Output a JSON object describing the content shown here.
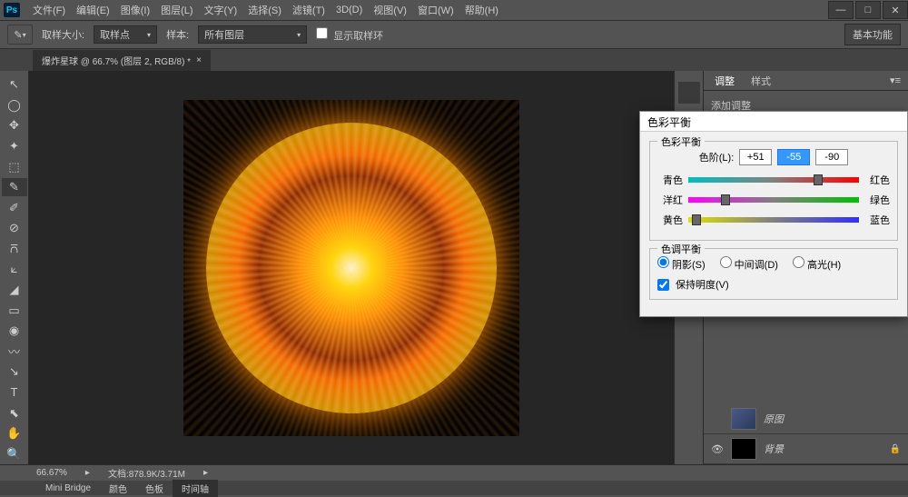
{
  "app": {
    "logo": "Ps"
  },
  "menu": {
    "items": [
      "文件(F)",
      "编辑(E)",
      "图像(I)",
      "图层(L)",
      "文字(Y)",
      "选择(S)",
      "滤镜(T)",
      "3D(D)",
      "视图(V)",
      "窗口(W)",
      "帮助(H)"
    ]
  },
  "options": {
    "sample_size_label": "取样大小:",
    "sample_size_value": "取样点",
    "sample_label": "样本:",
    "sample_value": "所有图层",
    "show_ring": "显示取样环",
    "func_btn": "基本功能"
  },
  "doc_tab": {
    "title": "爆炸星球 @ 66.7% (图层 2, RGB/8) *"
  },
  "tools": [
    "↖",
    "◯",
    "✥",
    "✦",
    "⬚",
    "✎",
    "✐",
    "⊘",
    "⩃",
    "⟀",
    "◢",
    "▭",
    "◉",
    "〰",
    "↘",
    "T",
    "⬉",
    "✋",
    "🔍"
  ],
  "right": {
    "tabs": [
      "调整",
      "样式"
    ],
    "add_adjust": "添加调整"
  },
  "layers": [
    {
      "name": "原图",
      "thumb_bg": "linear-gradient(135deg,#4a5a8a,#2a3a5a)"
    },
    {
      "name": "背景",
      "thumb_bg": "#000",
      "locked": true,
      "visible": true
    }
  ],
  "status": {
    "zoom": "66.67%",
    "doc_label": "文档:",
    "doc_size": "878.9K/3.71M"
  },
  "bottom_tabs": [
    "Mini Bridge",
    "颜色",
    "色板",
    "时间轴"
  ],
  "dialog": {
    "title": "色彩平衡",
    "group1_title": "色彩平衡",
    "levels_label": "色阶(L):",
    "level1": "+51",
    "level2": "-55",
    "level3": "-90",
    "sliders": [
      {
        "left": "青色",
        "right": "红色",
        "pos": 76
      },
      {
        "left": "洋红",
        "right": "绿色",
        "pos": 22
      },
      {
        "left": "黄色",
        "right": "蓝色",
        "pos": 5
      }
    ],
    "group2_title": "色调平衡",
    "radio_shadows": "阴影(S)",
    "radio_midtones": "中间调(D)",
    "radio_highlights": "高光(H)",
    "preserve_lum": "保持明度(V)"
  }
}
